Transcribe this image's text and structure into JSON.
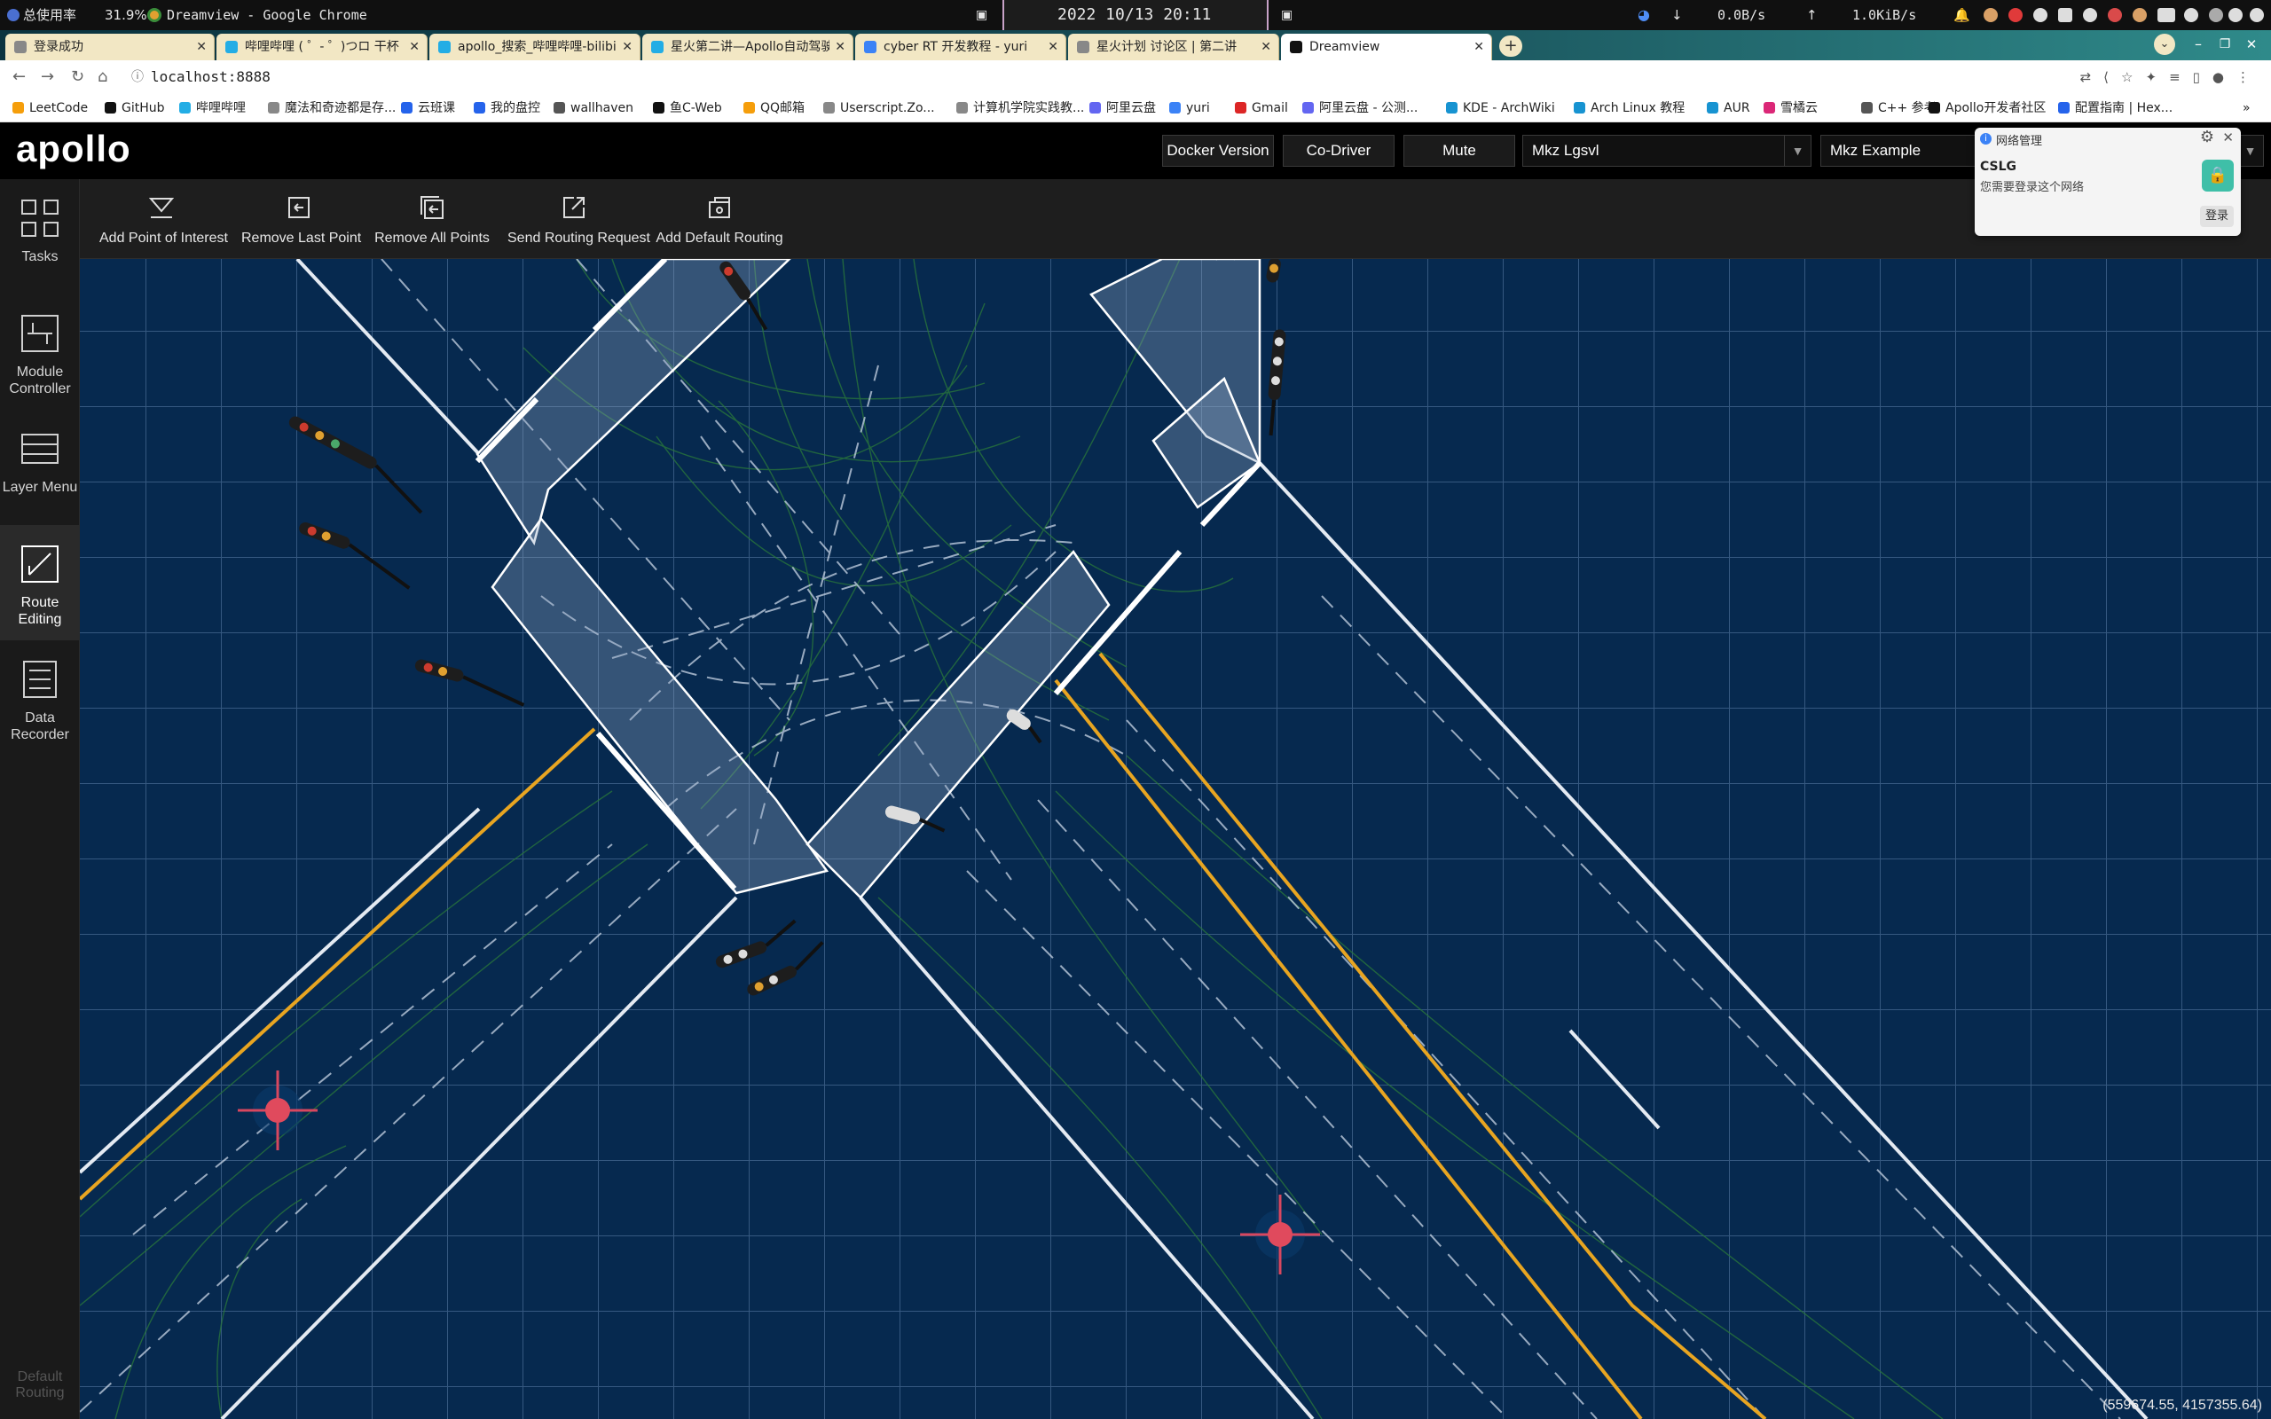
{
  "os_panel": {
    "app_name": "总使用率",
    "cpu": "31.9%",
    "window_title": "Dreamview - Google Chrome",
    "clock": "2022 10/13 20:11",
    "net_down": "0.0B/s",
    "net_up": "1.0KiB/s"
  },
  "tabs": [
    {
      "label": "登录成功",
      "favicon_color": "#888888"
    },
    {
      "label": "哔哩哔哩 ( ゜- ゜)つロ 干杯",
      "favicon_color": "#23ade5"
    },
    {
      "label": "apollo_搜索_哔哩哔哩-bilibili",
      "favicon_color": "#23ade5"
    },
    {
      "label": "星火第二讲—Apollo自动驾驶",
      "favicon_color": "#23ade5"
    },
    {
      "label": "cyber RT 开发教程 - yuri",
      "favicon_color": "#3b82f6"
    },
    {
      "label": "星火计划 讨论区 | 第二讲",
      "favicon_color": "#888888"
    },
    {
      "label": "Dreamview",
      "favicon_color": "#111111"
    }
  ],
  "address_bar": {
    "url": "localhost:8888"
  },
  "bookmarks": [
    {
      "label": "LeetCode",
      "color": "#f59e0b"
    },
    {
      "label": "GitHub",
      "color": "#111111"
    },
    {
      "label": "哔哩哔哩",
      "color": "#23ade5"
    },
    {
      "label": "魔法和奇迹都是存...",
      "color": "#888888"
    },
    {
      "label": "云班课",
      "color": "#2563eb"
    },
    {
      "label": "我的盘控",
      "color": "#2563eb"
    },
    {
      "label": "wallhaven",
      "color": "#555555"
    },
    {
      "label": "鱼C-Web",
      "color": "#111111"
    },
    {
      "label": "QQ邮箱",
      "color": "#f59e0b"
    },
    {
      "label": "Userscript.Zo...",
      "color": "#888888"
    },
    {
      "label": "计算机学院实践教...",
      "color": "#888888"
    },
    {
      "label": "阿里云盘",
      "color": "#6366f1"
    },
    {
      "label": "yuri",
      "color": "#3b82f6"
    },
    {
      "label": "Gmail",
      "color": "#dc2626"
    },
    {
      "label": "阿里云盘 - 公测...",
      "color": "#6366f1"
    },
    {
      "label": "KDE - ArchWiki",
      "color": "#1793d1"
    },
    {
      "label": "Arch Linux 教程",
      "color": "#1793d1"
    },
    {
      "label": "AUR",
      "color": "#1793d1"
    },
    {
      "label": "雪橘云",
      "color": "#db2777"
    },
    {
      "label": "C++ 参考",
      "color": "#555555"
    },
    {
      "label": "Apollo开发者社区",
      "color": "#111111"
    },
    {
      "label": "配置指南 | Hex...",
      "color": "#2563eb"
    }
  ],
  "header": {
    "logo": "apollo",
    "buttons": [
      "Docker Version",
      "Co-Driver",
      "Mute"
    ],
    "vehicle_select": "Mkz Lgsvl",
    "map_select": "Mkz Example"
  },
  "sidebar": {
    "items": [
      {
        "label": "Tasks",
        "icon": "grid-icon"
      },
      {
        "label": "Module Controller",
        "icon": "module-controller-icon"
      },
      {
        "label": "Layer Menu",
        "icon": "layer-menu-icon"
      },
      {
        "label": "Route Editing",
        "icon": "route-editing-icon",
        "active": true
      },
      {
        "label": "Data Recorder",
        "icon": "data-recorder-icon"
      }
    ],
    "default_routing": "Default Routing"
  },
  "toolbar": {
    "items": [
      {
        "label": "Add Point of Interest",
        "icon": "add-point-icon"
      },
      {
        "label": "Remove Last Point",
        "icon": "remove-last-point-icon"
      },
      {
        "label": "Remove All Points",
        "icon": "remove-all-points-icon"
      },
      {
        "label": "Send Routing Request",
        "icon": "send-routing-icon"
      },
      {
        "label": "Add Default Routing",
        "icon": "add-default-routing-icon"
      }
    ]
  },
  "map": {
    "coordinates": "(559674.55, 4157355.64)",
    "background_color": "#06294f",
    "lane_yellow": "#e8a521"
  },
  "notification": {
    "title": "网络管理",
    "network_name": "CSLG",
    "message": "您需要登录这个网络",
    "button": "登录"
  }
}
